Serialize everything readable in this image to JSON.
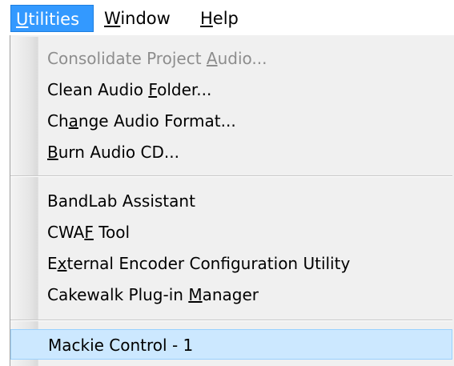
{
  "menubar": {
    "items": [
      {
        "pre": "",
        "mn": "U",
        "post": "tilities"
      },
      {
        "pre": "",
        "mn": "W",
        "post": "indow"
      },
      {
        "pre": "",
        "mn": "H",
        "post": "elp"
      }
    ]
  },
  "menu": {
    "items": [
      {
        "pre": "Consolidate Project ",
        "mn": "A",
        "post": "udio...",
        "disabled": true
      },
      {
        "pre": "Clean Audio ",
        "mn": "F",
        "post": "older..."
      },
      {
        "pre": "Ch",
        "mn": "a",
        "post": "nge Audio Format..."
      },
      {
        "pre": "",
        "mn": "B",
        "post": "urn Audio CD..."
      },
      {
        "pre": "BandLab Assistant",
        "mn": "",
        "post": ""
      },
      {
        "pre": "CWA",
        "mn": "F",
        "post": " Tool"
      },
      {
        "pre": "E",
        "mn": "x",
        "post": "ternal Encoder Configuration Utility"
      },
      {
        "pre": "Cakewalk Plug-in ",
        "mn": "M",
        "post": "anager"
      },
      {
        "pre": "Mackie Control - 1",
        "mn": "",
        "post": "",
        "highlighted": true
      }
    ]
  },
  "colors": {
    "menubar_active_bg": "#3399ff",
    "highlight_bg": "#cce8ff",
    "disabled_text": "#8d8d8d",
    "menu_bg": "#f0f0f0"
  }
}
